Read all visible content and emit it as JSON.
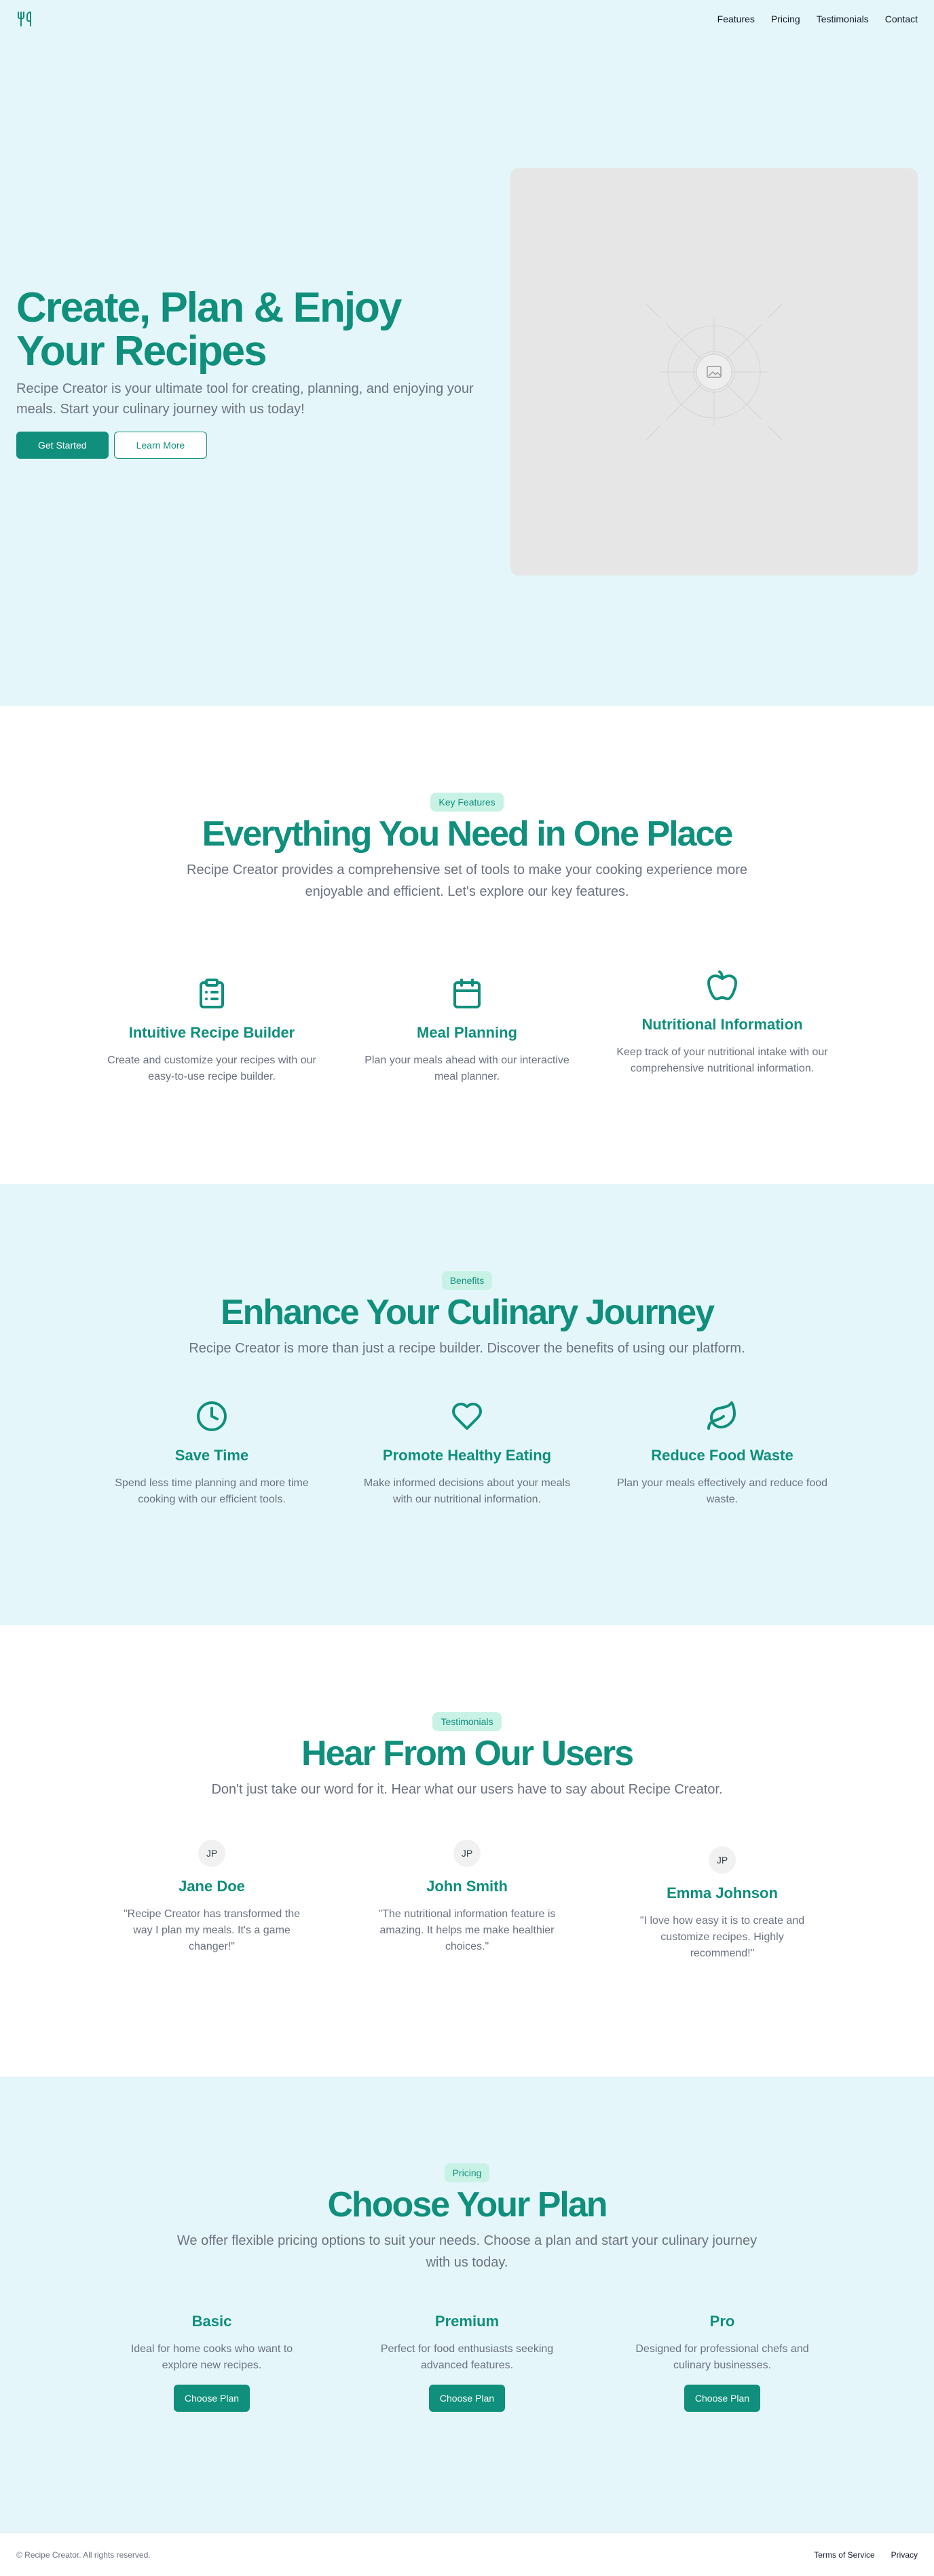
{
  "header": {
    "logo_icon": "utensils-icon",
    "nav": [
      "Features",
      "Pricing",
      "Testimonials",
      "Contact"
    ]
  },
  "hero": {
    "title": "Create, Plan & Enjoy Your Recipes",
    "subtitle": "Recipe Creator is your ultimate tool for creating, planning, and enjoying your meals. Start your culinary journey with us today!",
    "primary_button": "Get Started",
    "secondary_button": "Learn More",
    "image_icon": "image-placeholder-icon"
  },
  "features": {
    "badge": "Key Features",
    "title": "Everything You Need in One Place",
    "subtitle": "Recipe Creator provides a comprehensive set of tools to make your cooking experience more enjoyable and efficient. Let's explore our key features.",
    "items": [
      {
        "icon": "clipboard-list-icon",
        "title": "Intuitive Recipe Builder",
        "text": "Create and customize your recipes with our easy-to-use recipe builder."
      },
      {
        "icon": "calendar-icon",
        "title": "Meal Planning",
        "text": "Plan your meals ahead with our interactive meal planner."
      },
      {
        "icon": "apple-icon",
        "title": "Nutritional Information",
        "text": "Keep track of your nutritional intake with our comprehensive nutritional information."
      }
    ]
  },
  "benefits": {
    "badge": "Benefits",
    "title": "Enhance Your Culinary Journey",
    "subtitle": "Recipe Creator is more than just a recipe builder. Discover the benefits of using our platform.",
    "items": [
      {
        "icon": "clock-icon",
        "title": "Save Time",
        "text": "Spend less time planning and more time cooking with our efficient tools."
      },
      {
        "icon": "heart-icon",
        "title": "Promote Healthy Eating",
        "text": "Make informed decisions about your meals with our nutritional information."
      },
      {
        "icon": "leaf-icon",
        "title": "Reduce Food Waste",
        "text": "Plan your meals effectively and reduce food waste."
      }
    ]
  },
  "testimonials": {
    "badge": "Testimonials",
    "title": "Hear From Our Users",
    "subtitle": "Don't just take our word for it. Hear what our users have to say about Recipe Creator.",
    "items": [
      {
        "initials": "JP",
        "name": "Jane Doe",
        "quote": "\"Recipe Creator has transformed the way I plan my meals. It's a game changer!\""
      },
      {
        "initials": "JP",
        "name": "John Smith",
        "quote": "\"The nutritional information feature is amazing. It helps me make healthier choices.\""
      },
      {
        "initials": "JP",
        "name": "Emma Johnson",
        "quote": "\"I love how easy it is to create and customize recipes. Highly recommend!\""
      }
    ]
  },
  "pricing": {
    "badge": "Pricing",
    "title": "Choose Your Plan",
    "subtitle": "We offer flexible pricing options to suit your needs. Choose a plan and start your culinary journey with us today.",
    "plans": [
      {
        "name": "Basic",
        "text": "Ideal for home cooks who want to explore new recipes.",
        "button": "Choose Plan"
      },
      {
        "name": "Premium",
        "text": "Perfect for food enthusiasts seeking advanced features.",
        "button": "Choose Plan"
      },
      {
        "name": "Pro",
        "text": "Designed for professional chefs and culinary businesses.",
        "button": "Choose Plan"
      }
    ]
  },
  "footer": {
    "copyright": "© Recipe Creator. All rights reserved.",
    "links": [
      "Terms of Service",
      "Privacy"
    ]
  },
  "colors": {
    "accent": "#0f8f7c",
    "light_background": "#e4f6f9",
    "badge_background": "#c9f2e6"
  }
}
